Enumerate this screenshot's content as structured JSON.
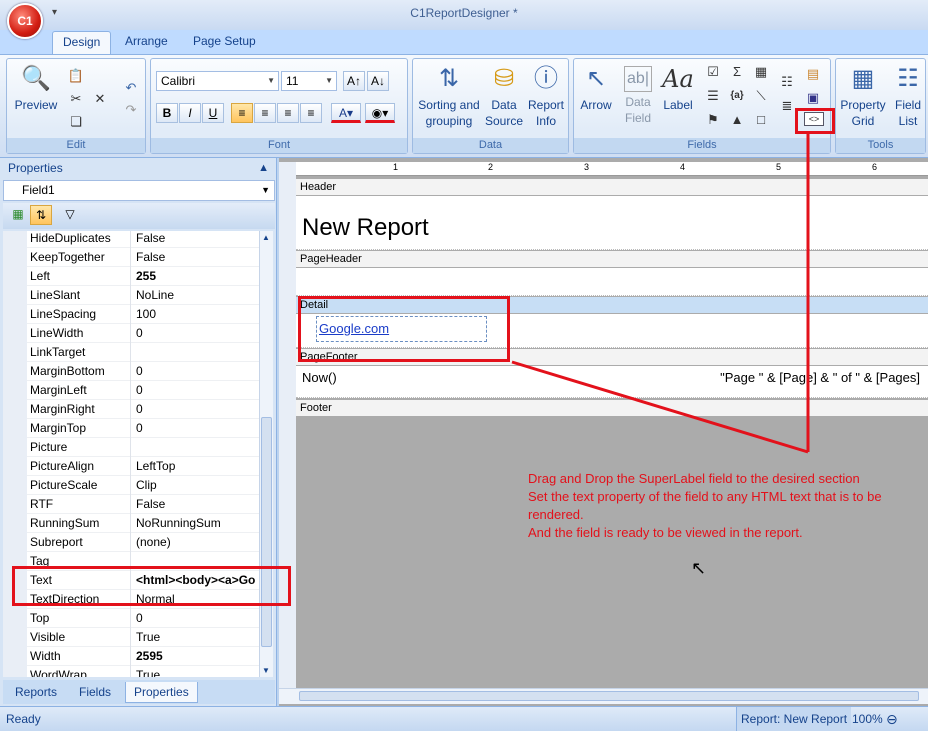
{
  "app": {
    "title": "C1ReportDesigner *",
    "app_button": "C1"
  },
  "tabs": [
    "Design",
    "Arrange",
    "Page Setup"
  ],
  "ribbon": {
    "edit": {
      "label": "Edit",
      "preview": "Preview"
    },
    "font": {
      "label": "Font",
      "family": "Calibri",
      "size": "11"
    },
    "data": {
      "label": "Data",
      "sorting": "Sorting and",
      "sorting2": "grouping",
      "source": "Data",
      "source2": "Source",
      "info": "Report",
      "info2": "Info"
    },
    "fields": {
      "label": "Fields",
      "arrow": "Arrow",
      "datafield": "Data",
      "datafield2": "Field",
      "labelbtn": "Label"
    },
    "tools": {
      "label": "Tools",
      "pgrid": "Property",
      "pgrid2": "Grid",
      "flist": "Field",
      "flist2": "List"
    }
  },
  "properties": {
    "caption": "Properties",
    "object": "Field1",
    "rows": [
      {
        "name": "HideDuplicates",
        "value": "False"
      },
      {
        "name": "KeepTogether",
        "value": "False"
      },
      {
        "name": "Left",
        "value": "255",
        "bold": true
      },
      {
        "name": "LineSlant",
        "value": "NoLine"
      },
      {
        "name": "LineSpacing",
        "value": "100"
      },
      {
        "name": "LineWidth",
        "value": "0"
      },
      {
        "name": "LinkTarget",
        "value": ""
      },
      {
        "name": "MarginBottom",
        "value": "0"
      },
      {
        "name": "MarginLeft",
        "value": "0"
      },
      {
        "name": "MarginRight",
        "value": "0"
      },
      {
        "name": "MarginTop",
        "value": "0"
      },
      {
        "name": "Picture",
        "value": ""
      },
      {
        "name": "PictureAlign",
        "value": "LeftTop"
      },
      {
        "name": "PictureScale",
        "value": "Clip"
      },
      {
        "name": "RTF",
        "value": "False"
      },
      {
        "name": "RunningSum",
        "value": "NoRunningSum"
      },
      {
        "name": "Subreport",
        "value": "(none)"
      },
      {
        "name": "Tag",
        "value": ""
      },
      {
        "name": "Text",
        "value": "<html><body><a>Go",
        "bold": true
      },
      {
        "name": "TextDirection",
        "value": "Normal"
      },
      {
        "name": "Top",
        "value": "0"
      },
      {
        "name": "Visible",
        "value": "True"
      },
      {
        "name": "Width",
        "value": "2595",
        "bold": true
      },
      {
        "name": "WordWrap",
        "value": "True"
      }
    ]
  },
  "bottom_tabs": [
    "Reports",
    "Fields",
    "Properties"
  ],
  "report": {
    "header_band": "Header",
    "title": "New Report",
    "pageheader_band": "PageHeader",
    "detail_band": "Detail",
    "detail_field": "Google.com",
    "pagefooter_band": "PageFooter",
    "now_field": "Now()",
    "pages_field": "\"Page \" & [Page] & \" of \" & [Pages]",
    "footer_band": "Footer",
    "ruler": [
      "1",
      "2",
      "3",
      "4",
      "5",
      "6"
    ]
  },
  "annotation": [
    "Drag and Drop the SuperLabel field to the desired section",
    "Set the text property of the field to any HTML text that is to be rendered.",
    "And the field is ready to be viewed in the report."
  ],
  "status": {
    "left": "Ready",
    "report": "Report: New Report",
    "zoom": "100%"
  },
  "colors": {
    "accent": "#e3111b",
    "ribbon": "#dbe7f6"
  }
}
